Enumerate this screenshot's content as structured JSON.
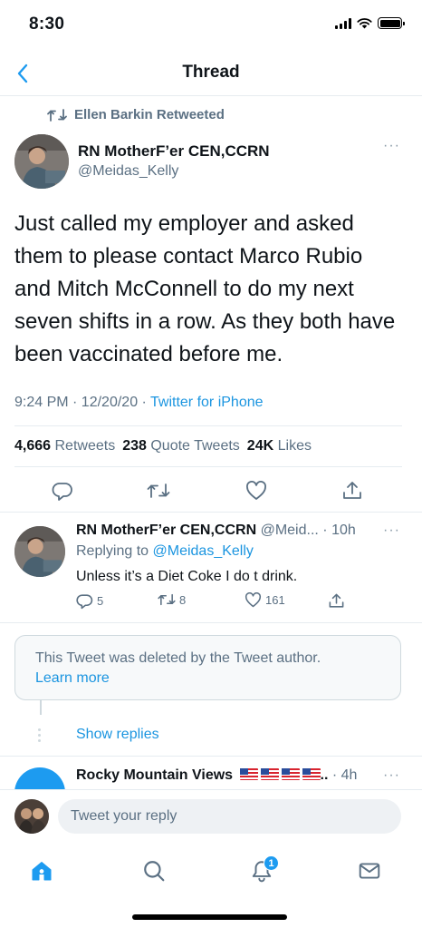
{
  "status_bar": {
    "time": "8:30"
  },
  "nav": {
    "title": "Thread"
  },
  "retweet_context": {
    "label": "Ellen Barkin Retweeted"
  },
  "main_tweet": {
    "author_name": "RN MotherF’er CEN,CCRN",
    "handle": "@Meidas_Kelly",
    "text": "Just called my employer and asked them to please contact Marco Rubio and Mitch McConnell to do my next seven shifts in a row. As they both have been vaccinated before me.",
    "time_date": "9:24 PM · 12/20/20 · ",
    "source": "Twitter for iPhone",
    "retweets_count": "4,666",
    "retweets_label": "Retweets",
    "quote_count": "238",
    "quote_label": "Quote Tweets",
    "likes_count": "24K",
    "likes_label": "Likes",
    "more_glyph": "···"
  },
  "reply_tweet": {
    "author_name": "RN MotherF’er CEN,CCRN",
    "handle": "@Meid...",
    "time": "· 10h",
    "replying_to_prefix": "Replying to ",
    "replying_to_handle": "@Meidas_Kelly",
    "text": "Unless it’s a Diet Coke I do t drink.",
    "reply_count": "5",
    "retweet_count": "8",
    "like_count": "161",
    "more_glyph": "···"
  },
  "deleted_tweet": {
    "message": "This Tweet was deleted by the Tweet author.",
    "learn_more": "Learn more"
  },
  "show_replies": "Show replies",
  "third_tweet": {
    "author_name": "Rocky Mountain Views",
    "ellipsis": "..",
    "time": "· 4h",
    "more_glyph": "···"
  },
  "compose": {
    "placeholder": "Tweet your reply"
  },
  "tab_bar": {
    "notification_badge": "1"
  },
  "colors": {
    "accent": "#1d9bf0",
    "muted": "#5b7083",
    "divider": "#e6ecf0"
  },
  "icons": {
    "back": "chevron-left-icon",
    "retweet": "retweet-icon",
    "reply": "reply-icon",
    "like": "heart-icon",
    "share": "share-icon",
    "home": "home-icon",
    "search": "search-icon",
    "notifications": "bell-icon",
    "messages": "mail-icon"
  }
}
